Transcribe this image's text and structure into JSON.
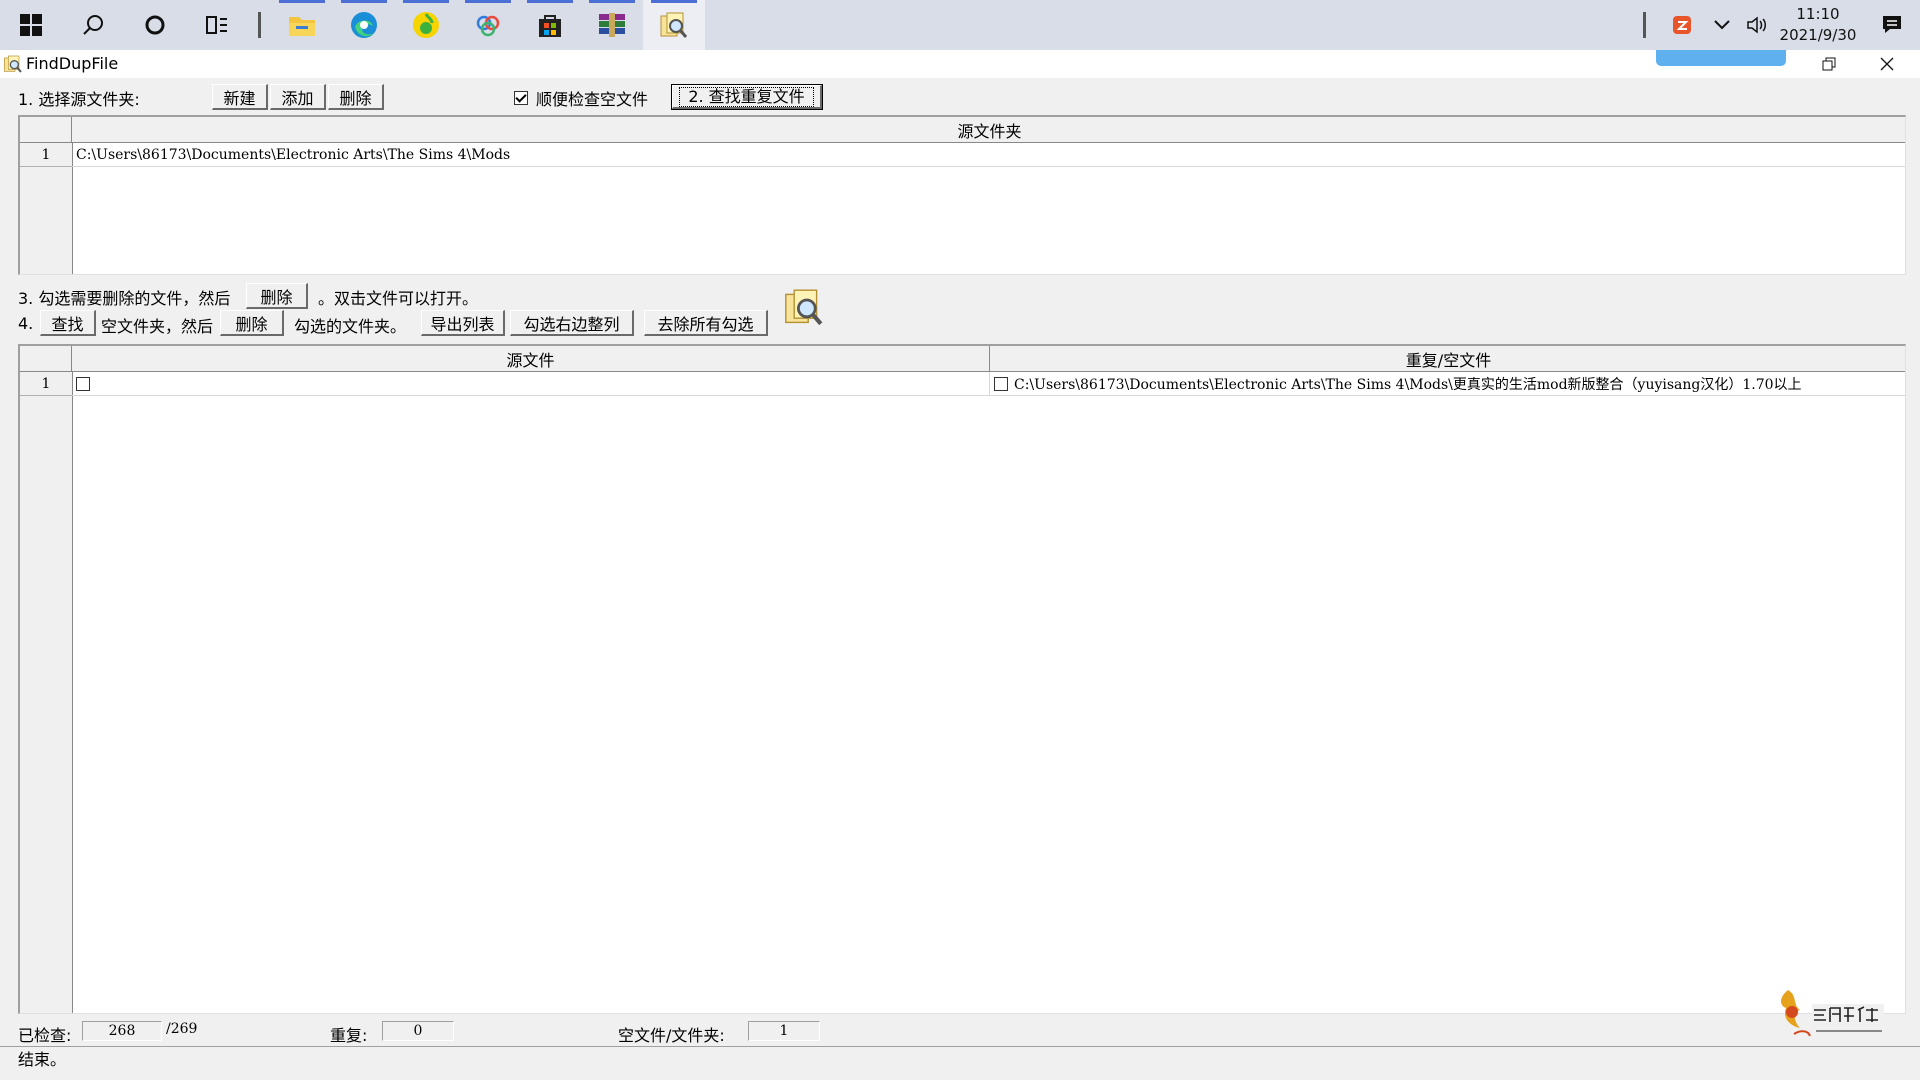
{
  "taskbar": {
    "apps": [
      {
        "icon": "windows-start-icon"
      },
      {
        "icon": "search-icon"
      },
      {
        "icon": "cortana-icon"
      },
      {
        "icon": "task-view-icon"
      },
      {
        "icon": "file-explorer-icon"
      },
      {
        "icon": "edge-browser-icon"
      },
      {
        "icon": "music-app-icon"
      },
      {
        "icon": "cloud-app-icon"
      },
      {
        "icon": "store-icon"
      },
      {
        "icon": "winrar-icon"
      },
      {
        "icon": "finddupfile-app-icon"
      }
    ],
    "clock": {
      "time": "11:10",
      "date": "2021/9/30"
    },
    "tray_icons": [
      "antivirus-icon",
      "chevron-up-icon",
      "volume-icon",
      "notification-icon"
    ]
  },
  "window": {
    "title": "FindDupFile",
    "controls": [
      "restore-icon",
      "close-icon"
    ]
  },
  "step1": {
    "label": "1. 选择源文件夹:",
    "new_btn": "新建",
    "add_btn": "添加",
    "delete_btn": "删除",
    "check_empty_label": "顺便检查空文件",
    "check_empty_checked": true,
    "find_dup_btn": "2. 查找重复文件"
  },
  "folder_grid": {
    "header": "源文件夹",
    "rows": [
      {
        "num": "1",
        "path": "C:\\Users\\86173\\Documents\\Electronic Arts\\The Sims 4\\Mods"
      }
    ]
  },
  "step3": {
    "prefix": "3. 勾选需要删除的文件，然后",
    "delete_btn": "删除",
    "suffix": "。双击文件可以打开。"
  },
  "step4": {
    "prefix": "4.",
    "find_btn": "查找",
    "mid_text": "空文件夹，然后",
    "delete_btn": "删除",
    "suffix": "勾选的文件夹。",
    "export_btn": "导出列表",
    "check_right_btn": "勾选右边整列",
    "clear_checks_btn": "去除所有勾选"
  },
  "result_grid": {
    "col_source": "源文件",
    "col_dup": "重复/空文件",
    "rows": [
      {
        "num": "1",
        "source": "",
        "dup": "C:\\Users\\86173\\Documents\\Electronic Arts\\The Sims 4\\Mods\\更真实的生活mod新版整合（yuyisang汉化）1.70以上"
      }
    ]
  },
  "status": {
    "checked_label": "已检查:",
    "checked_value": "268",
    "checked_total": "/269",
    "dup_label": "重复:",
    "dup_value": "0",
    "empty_label": "空文件/文件夹:",
    "empty_value": "1",
    "message": "结束。"
  }
}
